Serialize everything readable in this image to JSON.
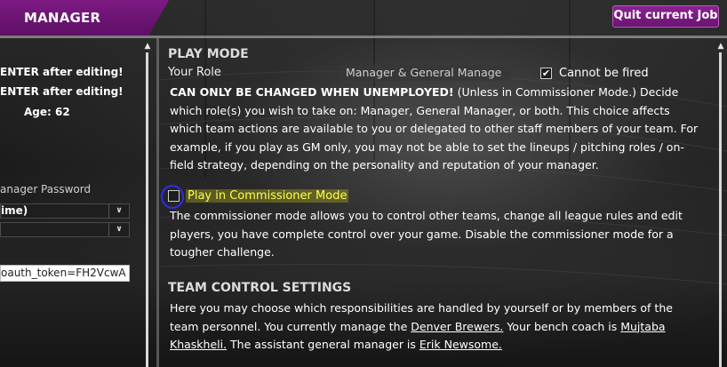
{
  "header": {
    "title": "MANAGER OPTIONS",
    "quit_label": "Quit current Job"
  },
  "left": {
    "line1": "ENTER after editing!",
    "line2": "ENTER after editing!",
    "age": "Age: 62",
    "password_label": "anager Password",
    "select1_value": "ime)",
    "select2_value": "",
    "token_value": "oauth_token=FH2VcwA"
  },
  "play_mode": {
    "title": "PLAY MODE",
    "role_label": "Your Role",
    "role_value": "Manager & General Manage",
    "cannot_fired_label": "Cannot be fired",
    "cannot_fired_checked": true,
    "role_description_bold": "CAN ONLY BE CHANGED WHEN UNEMPLOYED!",
    "role_description": " (Unless in Commissioner Mode.) Decide which role(s) you wish to take on: Manager, General Manager, or both.  This choice affects which team actions are available to you or delegated to other staff members of your team. For example, if you play as GM only, you may not be able to set the lineups / pitching roles / on-field strategy, depending on the personality and reputation of your manager.",
    "commissioner_label": "Play in Commissioner Mode",
    "commissioner_checked": false,
    "commissioner_description": "The commissioner mode allows you to control other teams, change all league rules and edit players, you have complete control over your game. Disable the commissioner mode for a tougher challenge."
  },
  "team_control": {
    "title": "TEAM CONTROL SETTINGS",
    "desc_part1": "Here you may choose which responsibilities are handled by yourself or by members of the team personnel. You currently manage the ",
    "team_link": "Denver Brewers.",
    "desc_part2": " Your bench coach is ",
    "coach_link": "Mujtaba Khaskheli.",
    "desc_part3": " The assistant general manager is ",
    "agm_link": "Erik Newsome."
  },
  "colors": {
    "accent": "#7d1a83",
    "highlight_text": "#ffff4a",
    "annotation_circle": "#2d2df0"
  },
  "icons": {
    "scroll_up": "triangle-up",
    "select_arrow": "chevron-down",
    "checkmark": "checkmark"
  }
}
